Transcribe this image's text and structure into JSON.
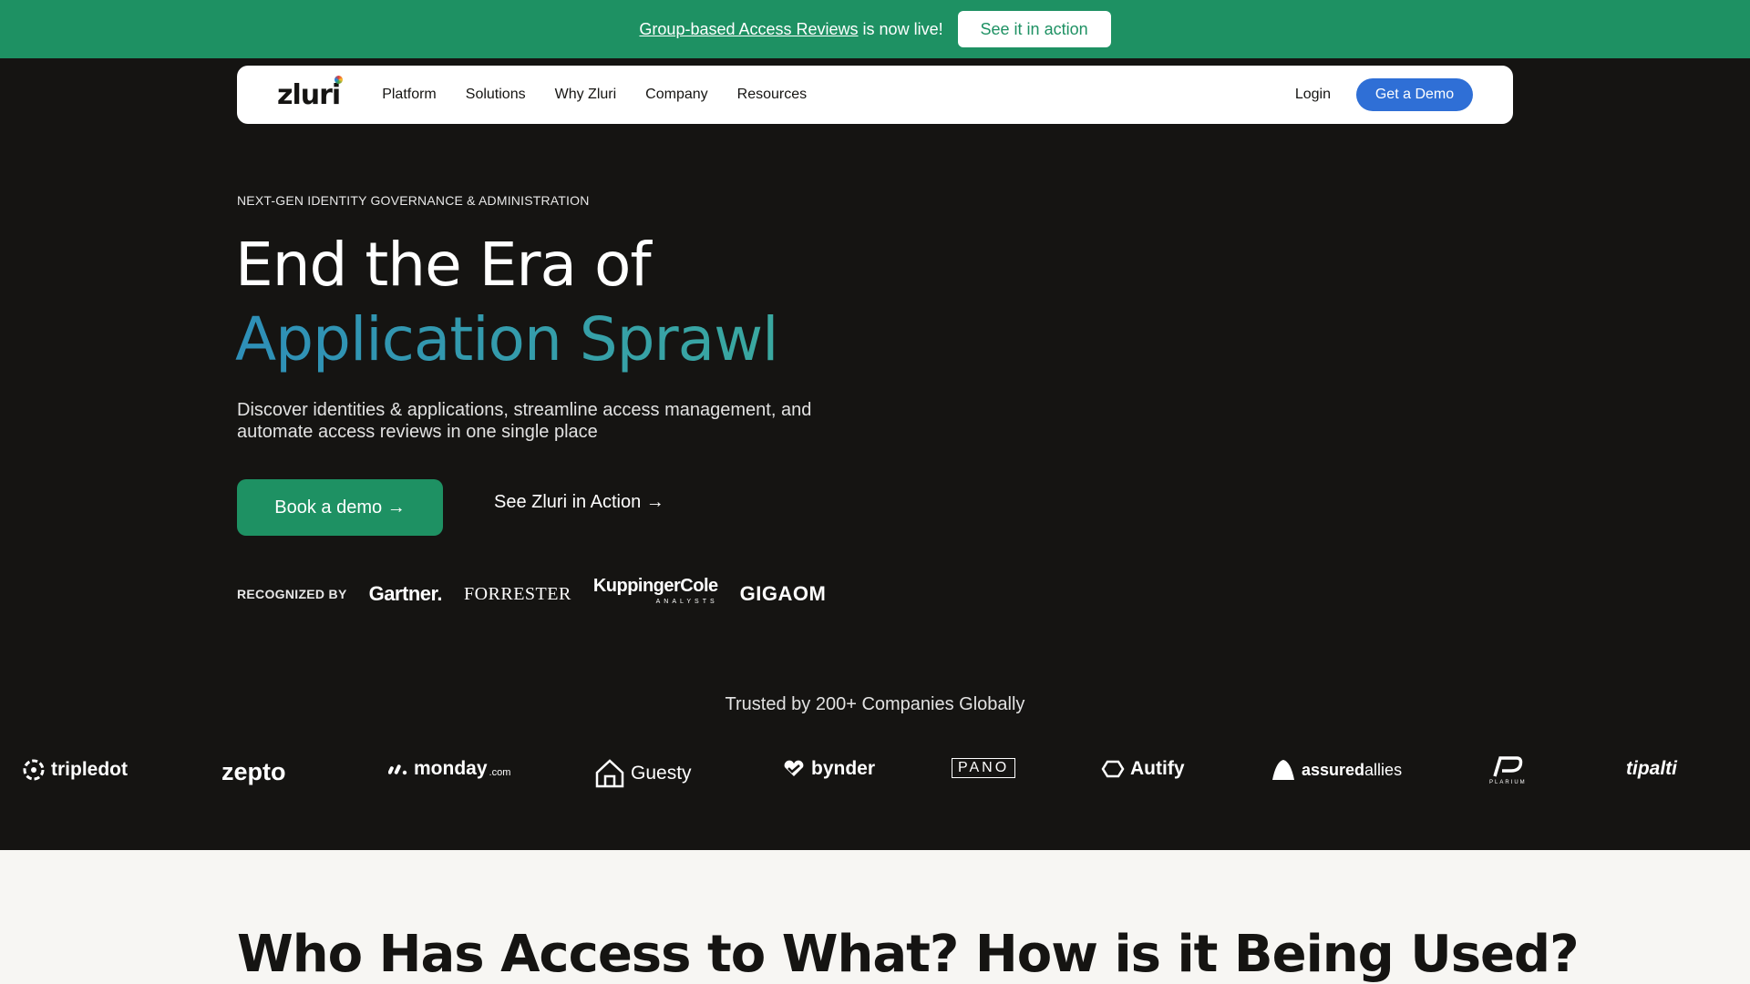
{
  "announcement": {
    "link_text": "Group-based Access Reviews",
    "suffix": "is now live!",
    "button_label": "See it in action"
  },
  "nav": {
    "logo": "zluri",
    "links": [
      "Platform",
      "Solutions",
      "Why Zluri",
      "Company",
      "Resources"
    ],
    "login_label": "Login",
    "demo_label": "Get a Demo"
  },
  "hero": {
    "eyebrow": "NEXT-GEN IDENTITY GOVERNANCE & ADMINISTRATION",
    "title_line1": "End the Era of",
    "title_line2": "Application Sprawl",
    "subtitle": "Discover identities & applications, streamline access management, and automate access reviews in one single place",
    "primary_cta": "Book a demo →",
    "secondary_cta": "See Zluri in Action →"
  },
  "recognized": {
    "label": "RECOGNIZED BY",
    "logos": [
      "Gartner.",
      "FORRESTER",
      "KuppingerCole",
      "ANALYSTS",
      "GIGAOM"
    ]
  },
  "trusted": {
    "heading": "Trusted by 200+ Companies Globally",
    "clients": [
      "tripledot",
      "zepto",
      "monday",
      ".com",
      "Guesty",
      "bynder",
      "PANO",
      "Autify",
      "assured",
      "allies",
      "PLARIUM",
      "tipalti"
    ]
  },
  "section2": {
    "title": "Who Has Access to What? How is it Being Used?"
  },
  "colors": {
    "brand_green": "#1e9163",
    "demo_blue": "#2f6fd6",
    "hero_bg": "#151412",
    "gradient_start": "#2e8fb8",
    "gradient_end": "#3aa8a0"
  }
}
